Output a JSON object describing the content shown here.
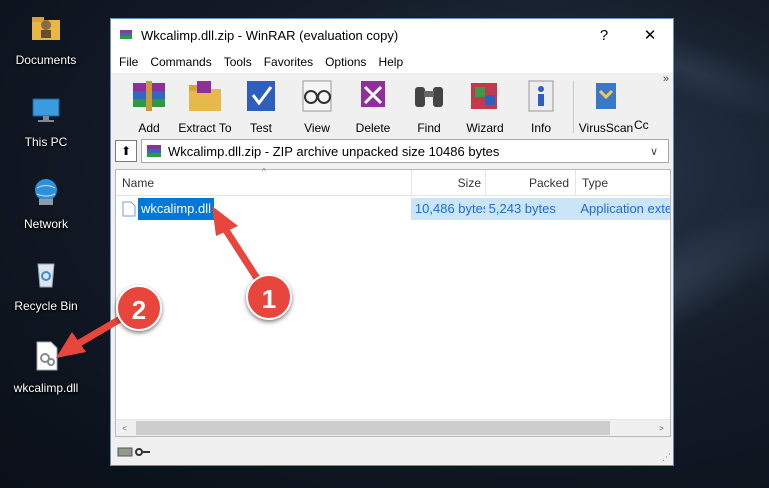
{
  "desktop": {
    "icons": [
      {
        "label": "Documents",
        "icon": "folder-documents-icon"
      },
      {
        "label": "This PC",
        "icon": "computer-icon"
      },
      {
        "label": "Network",
        "icon": "network-globe-icon"
      },
      {
        "label": "Recycle Bin",
        "icon": "recycle-bin-icon"
      },
      {
        "label": "wkcalimp.dll",
        "icon": "dll-file-icon"
      }
    ]
  },
  "window": {
    "title": "Wkcalimp.dll.zip - WinRAR (evaluation copy)",
    "help_btn": "?",
    "close_btn": "✕"
  },
  "menu": [
    "File",
    "Commands",
    "Tools",
    "Favorites",
    "Options",
    "Help"
  ],
  "toolbar": {
    "buttons": [
      {
        "label": "Add",
        "icon": "books-add-icon"
      },
      {
        "label": "Extract To",
        "icon": "folder-extract-icon"
      },
      {
        "label": "Test",
        "icon": "checkmark-test-icon"
      },
      {
        "label": "View",
        "icon": "glasses-view-icon"
      },
      {
        "label": "Delete",
        "icon": "delete-icon"
      },
      {
        "label": "Find",
        "icon": "binoculars-find-icon"
      },
      {
        "label": "Wizard",
        "icon": "wizard-icon"
      },
      {
        "label": "Info",
        "icon": "info-icon"
      },
      {
        "label": "VirusScan",
        "icon": "virus-scan-icon"
      },
      {
        "label": "Cc",
        "icon": "comment-icon"
      }
    ],
    "more": "»"
  },
  "address": {
    "text": "Wkcalimp.dll.zip - ZIP archive unpacked size 10486 bytes",
    "up": "⬆",
    "chev": "∨"
  },
  "columns": {
    "name": "Name",
    "size": "Size",
    "packed": "Packed",
    "type": "Type",
    "sort": "^"
  },
  "files": [
    {
      "name": "wkcalimp.dll",
      "size": "10,486 bytes",
      "packed": "5,243 bytes",
      "type": "Application extension"
    }
  ],
  "scroll": {
    "left": "<",
    "right": ">"
  },
  "annotations": [
    {
      "number": "1"
    },
    {
      "number": "2"
    }
  ],
  "colors": {
    "accent": "#0078d7",
    "callout": "#e8453c",
    "selection": "#cce4f7"
  }
}
